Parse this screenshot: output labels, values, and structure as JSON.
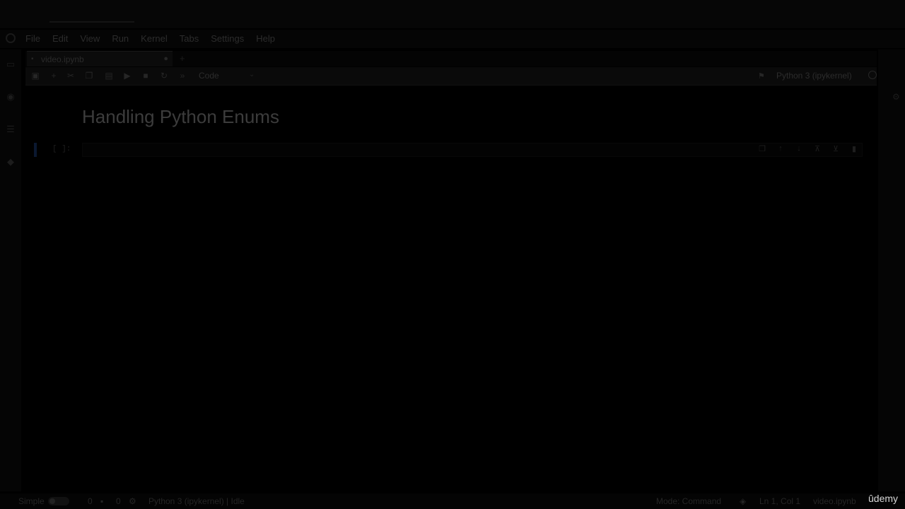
{
  "window": {
    "title": ""
  },
  "menu": {
    "items": [
      "File",
      "Edit",
      "View",
      "Run",
      "Kernel",
      "Tabs",
      "Settings",
      "Help"
    ]
  },
  "tabs": [
    {
      "label": "video.ipynb",
      "close": "●"
    }
  ],
  "toolbar": {
    "buttons": [
      "save-icon",
      "add-icon",
      "cut-icon",
      "copy-icon",
      "paste-icon",
      "run-icon",
      "stop-icon",
      "restart-icon",
      "fast-forward-icon"
    ],
    "cell_type": "Code",
    "kernel_name": "Python 3 (ipykernel)"
  },
  "notebook": {
    "title": "Handling Python Enums",
    "cells": [
      {
        "prompt": "[ ]:",
        "source": ""
      }
    ]
  },
  "statusbar": {
    "simple_label": "Simple",
    "count_a": "0",
    "count_b": "0",
    "kernel_status": "Python 3 (ipykernel) | Idle",
    "mode": "Mode: Command",
    "position": "Ln 1, Col 1",
    "file": "video.ipynb"
  },
  "watermark": {
    "text": "ûdemy"
  }
}
